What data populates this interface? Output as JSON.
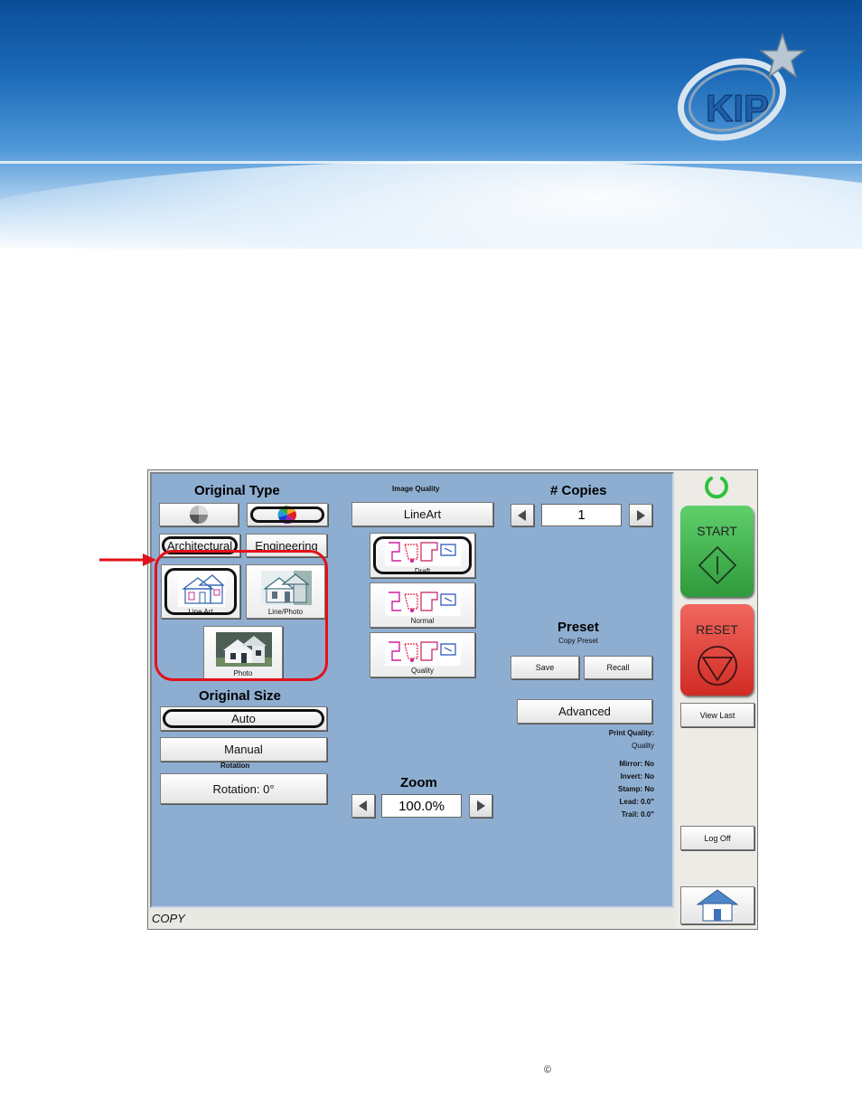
{
  "brand": {
    "logo_text": "KIP"
  },
  "app": {
    "original_type": {
      "title": "Original Type",
      "mode_buttons": [
        {
          "icon": "grayscale-icon",
          "selected": false
        },
        {
          "icon": "color-wheel-icon",
          "selected": true
        }
      ],
      "categories": [
        {
          "label": "Architectural",
          "selected": true
        },
        {
          "label": "Engineering",
          "selected": false
        }
      ],
      "types": [
        {
          "label": "Line Art",
          "selected": true
        },
        {
          "label": "Line/Photo",
          "selected": false
        },
        {
          "label": "Photo",
          "selected": false
        }
      ]
    },
    "original_size": {
      "title": "Original Size",
      "auto_label": "Auto",
      "manual_label": "Manual",
      "rotation_caption": "Rotation",
      "rotation_label": "Rotation: 0°"
    },
    "image_quality": {
      "title": "Image Quality",
      "value": "LineArt",
      "options": [
        {
          "label": "Draft",
          "selected": true
        },
        {
          "label": "Normal",
          "selected": false
        },
        {
          "label": "Quality",
          "selected": false
        }
      ]
    },
    "zoom": {
      "title": "Zoom",
      "value": "100.0%"
    },
    "copies": {
      "title": "# Copies",
      "value": "1"
    },
    "preset": {
      "title": "Preset",
      "subtitle": "Copy Preset",
      "save_label": "Save",
      "recall_label": "Recall"
    },
    "advanced_label": "Advanced",
    "summary": {
      "print_quality_label": "Print Quality:",
      "print_quality_value": "Quality",
      "mirror": "Mirror: No",
      "invert": "Invert: No",
      "stamp": "Stamp: No",
      "lead": "Lead: 0.0\"",
      "trail": "Trail: 0.0\""
    },
    "side": {
      "start_label": "START",
      "reset_label": "RESET",
      "view_last_label": "View Last",
      "log_off_label": "Log Off"
    },
    "status_text": "COPY"
  },
  "footer": {
    "copyright_symbol": "©"
  },
  "colors": {
    "panel": "#8eaed1",
    "start": "#3aa84a",
    "reset": "#e0332b",
    "highlight": "#e3101a"
  }
}
